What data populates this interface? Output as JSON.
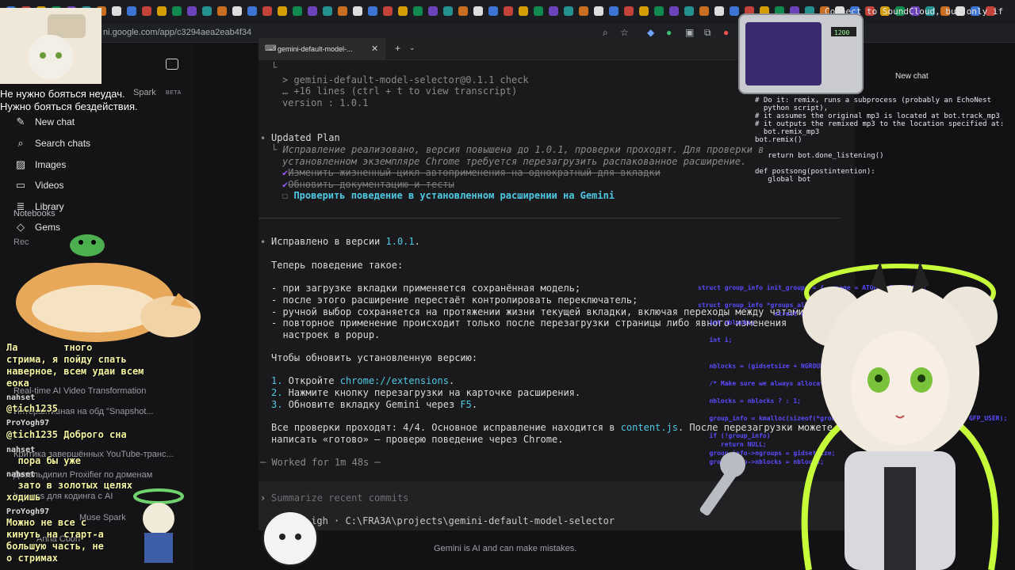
{
  "browser": {
    "url": "ni.google.com/app/c3294aea2eab4f34"
  },
  "sidebar": {
    "spark": "Spark",
    "beta": "BETA",
    "items": [
      {
        "label": "New chat",
        "icon": "edit-icon"
      },
      {
        "label": "Search chats",
        "icon": "search-icon"
      },
      {
        "label": "Images",
        "icon": "image-icon"
      },
      {
        "label": "Videos",
        "icon": "video-icon"
      },
      {
        "label": "Library",
        "icon": "library-icon"
      },
      {
        "label": "Gems",
        "icon": "gem-icon"
      }
    ],
    "notebooks": "Notebooks",
    "recent_heading": "Rec",
    "recents": [
      "Real-time AI Video Transformation",
      "Интерактивная на обд \"Snapshot...",
      "Критика завершённых YouTube-транс...",
      "Дезальдипил Proxifier по доменам",
      "harness для кодинга с AI",
      "Muse Spark",
      "Anna Coon"
    ]
  },
  "terminal": {
    "tab_title": "gemini-default-model-...",
    "lines": {
      "l0": "└",
      "l1": "> gemini-default-model-selector@0.1.1 check",
      "l2": "… +16 lines (ctrl + t to view transcript)",
      "l3": "version : 1.0.1",
      "plan_title": "Updated Plan",
      "plan_note1": "Исправление реализовано, версия повышена до 1.0.1, проверки проходят. Для проверки в",
      "plan_note2": "установленном экземпляре Chrome требуется перезагрузить распакованное расширение.",
      "plan_done1": "Изменить жизненный цикл автоприменения на однократный для вкладки",
      "plan_done2": "Обновить документацию и тесты",
      "plan_todo": "Проверить поведение в установленном расширении на Gemini",
      "fixed_prefix": "Исправлено в версии ",
      "fixed_version": "1.0.1",
      "fixed_suffix": ".",
      "behavior": "Теперь поведение такое:",
      "b1": "- при загрузке вкладки применяется сохранённая модель;",
      "b2": "- после этого расширение перестаёт контролировать переключатель;",
      "b3": "- ручной выбор сохраняется на протяжении жизни текущей вкладки, включая переходы между чатами;",
      "b4a": "- повторное применение происходит только после перезагрузки страницы либо явного изменения",
      "b4b": "  настроек в popup.",
      "update": "Чтобы обновить установленную версию:",
      "s1_num": "1.",
      "s1_text": " Откройте ",
      "s1_link": "chrome://extensions",
      "s1_end": ".",
      "s2_num": "2.",
      "s2_text": " Нажмите кнопку перезагрузки на карточке расширения.",
      "s3_num": "3.",
      "s3_text": " Обновите вкладку Gemini через ",
      "s3_link": "F5",
      "s3_end": ".",
      "checks1": "Все проверки проходят: 4/4. Основное исправление находится в ",
      "checks_file": "content.js",
      "checks2": ". После перезагрузки можете",
      "checks3": "написать «готово» — проверю поведение через Chrome.",
      "worked": "─ Worked for 1m 48s ─",
      "prompt_arrow": "›",
      "prompt_placeholder": "Summarize recent commits",
      "status": "sol high · C:\\FRA3A\\projects\\gemini-default-model-selector"
    }
  },
  "disclaimer": "Gemini is AI and can make mistakes.",
  "overlay": {
    "quote_line1": "Не нужно бояться неудач.",
    "quote_line2": "Нужно бояться бездействия.",
    "new_chat": "New chat",
    "connect": "Connect to SoundCloud, but only if we",
    "code_top": "# Do it: remix, runs a subprocess (probably an EchoNest\n  python script),\n# it assumes the original mp3 is located at bot.track_mp3\n# it outputs the remixed mp3 to the location specified at:\n  bot.remix_mp3\nbot.remix()\n\n   return bot.done_listening()\n\ndef postsong(postintention):\n   global bot",
    "code_c": "struct group_info init_groups = { .usage = ATOMIC_INIT(2) };\n\nstruct group_info *groups_alloc(int\n                    struct group_info *\n   int nblocks;\n\n   int i;\n\n\n   nblocks = (gidsetsize + NGROUPS_PER_BLOCK - 1) / NGROUPS_PER_BLOCK;\n\n   /* Make sure we always allocate at least one indirect block pointer */\n\n   nblocks = nblocks ? : 1;\n\n   group_info = kmalloc(sizeof(*group_info) + nblocks*sizeof(gid_t *), GFP_USER);\n\n   if (!group_info)\n      return NULL;\n   group_info->ngroups = gidsetsize;\n   group_info->nblocks = nblocks;",
    "chat": [
      {
        "name": "",
        "msg": "Ла        тного\nстрима, я пойду спать\nнаверное, всем удаи всем\nеока"
      },
      {
        "name": "nahset",
        "msg": "@tich1235"
      },
      {
        "name": "ProYogh97",
        "msg": "@tich1235 Доброго сна"
      },
      {
        "name": "nahset",
        "msg": "  пора бы уже"
      },
      {
        "name": "nahset",
        "msg": "  зато в золотых целях\nходишь"
      },
      {
        "name": "ProYogh97",
        "msg": "Можно не все с\nкинуть на старт-а\nбольшую часть, не\nо стримах"
      }
    ]
  },
  "colors": {
    "accent": "#4cc8e2",
    "plan_check": "#9b59ff",
    "chat_text": "#f4f4a0",
    "neon": "#c6ff3a"
  }
}
